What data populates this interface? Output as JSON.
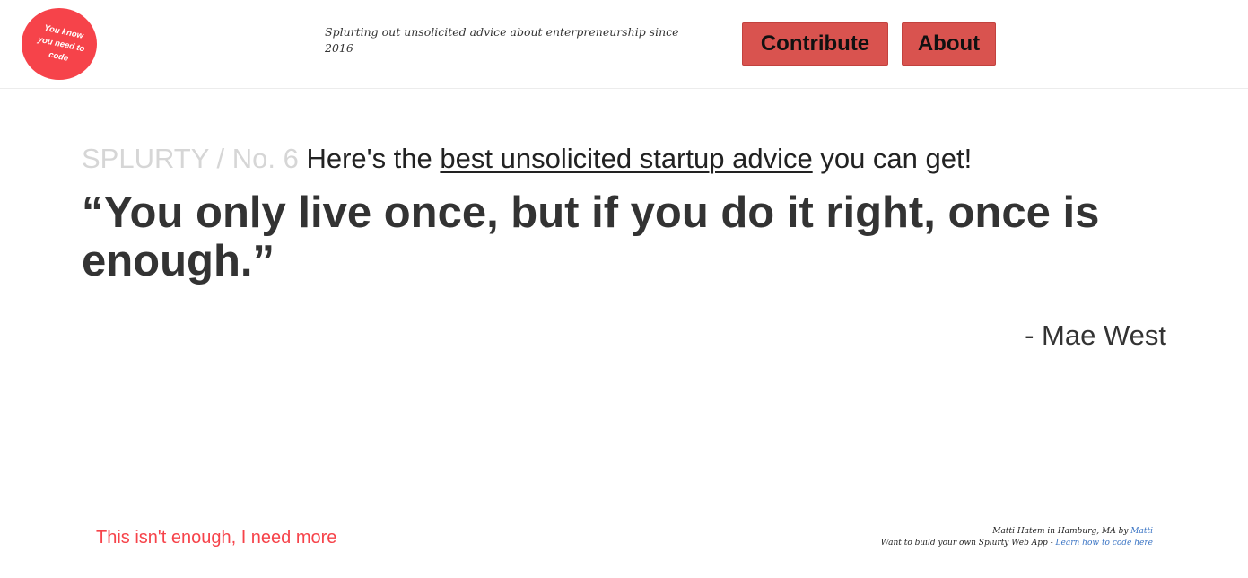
{
  "header": {
    "logo_text": "You know you need to code",
    "tagline": "Splurting out unsolicited advice about enterpreneurship since 2016",
    "nav": {
      "contribute_label": "Contribute",
      "about_label": "About"
    }
  },
  "main": {
    "brand": "SPLURTY",
    "issue": "No. 6",
    "intro_before": "Here's the",
    "intro_link": "best unsolicited startup advice",
    "intro_after": "you can get!",
    "quote": "“You only live once, but if you do it right, once is enough.”",
    "author": "- Mae West"
  },
  "footer": {
    "more_link": "This isn't enough, I need more",
    "credit_line1_prefix": "Matti Hatem in Hamburg, MA by",
    "credit_line1_link": "Matti",
    "credit_line2_prefix": "Want to build your own Splurty Web App -",
    "credit_line2_link": "Learn how to code here"
  },
  "colors": {
    "accent": "#f6434a",
    "button": "#d9534f",
    "muted": "#d6d6d6",
    "text": "#333333",
    "link": "#3a74c4"
  }
}
